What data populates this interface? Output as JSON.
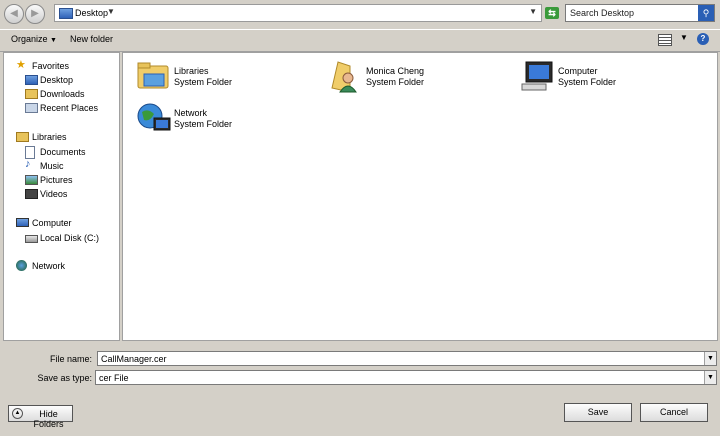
{
  "address": {
    "location": "Desktop"
  },
  "search": {
    "placeholder": "Search Desktop"
  },
  "toolbar": {
    "organize": "Organize",
    "new_folder": "New folder"
  },
  "nav": {
    "favorites": {
      "label": "Favorites",
      "items": [
        "Desktop",
        "Downloads",
        "Recent Places"
      ]
    },
    "libraries": {
      "label": "Libraries",
      "items": [
        "Documents",
        "Music",
        "Pictures",
        "Videos"
      ]
    },
    "computer": {
      "label": "Computer",
      "items": [
        "Local Disk (C:)"
      ]
    },
    "network": {
      "label": "Network"
    }
  },
  "items": [
    {
      "name": "Libraries",
      "type": "System Folder",
      "icon": "libraries-folder-icon"
    },
    {
      "name": "Monica Cheng",
      "type": "System Folder",
      "icon": "user-folder-icon"
    },
    {
      "name": "Computer",
      "type": "System Folder",
      "icon": "computer-icon"
    },
    {
      "name": "Network",
      "type": "System Folder",
      "icon": "network-icon"
    }
  ],
  "form": {
    "file_name_label": "File name:",
    "file_name_value": "CallManager.cer",
    "save_type_label": "Save as type:",
    "save_type_value": "cer File"
  },
  "buttons": {
    "hide_folders": "Hide Folders",
    "save": "Save",
    "cancel": "Cancel"
  }
}
